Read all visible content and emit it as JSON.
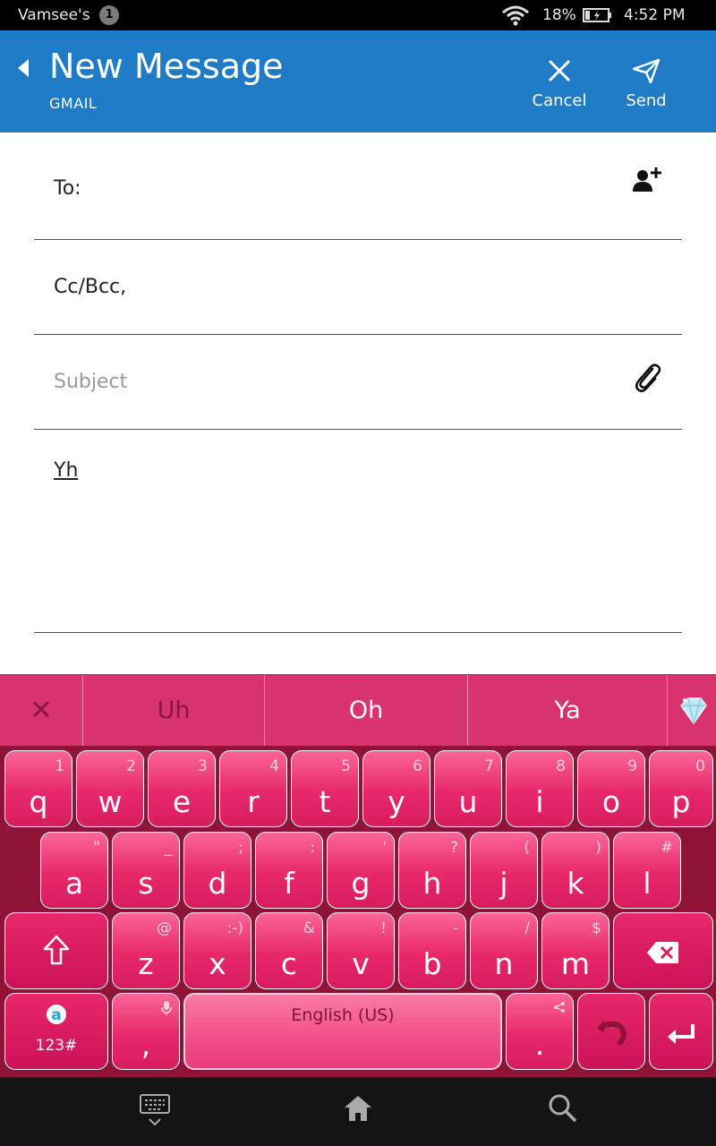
{
  "status_bar": {
    "owner": "Vamsee's",
    "notification_count": "1",
    "battery_percent": "18%",
    "time": "4:52 PM",
    "icons": [
      "wifi-icon",
      "battery-charging-icon"
    ]
  },
  "app_bar": {
    "title": "New Message",
    "subtitle": "GMAIL",
    "cancel_label": "Cancel",
    "send_label": "Send",
    "color": "#1f7bc6"
  },
  "compose": {
    "to_label": "To:",
    "cc_label": "Cc/Bcc,",
    "subject_placeholder": "Subject",
    "body_text": "Yh"
  },
  "suggestions": {
    "close_symbol": "✕",
    "items": [
      "Uh",
      "Oh",
      "Ya"
    ]
  },
  "keyboard": {
    "accent": "#e8286a",
    "row1": [
      {
        "main": "q",
        "sub": "1"
      },
      {
        "main": "w",
        "sub": "2"
      },
      {
        "main": "e",
        "sub": "3"
      },
      {
        "main": "r",
        "sub": "4"
      },
      {
        "main": "t",
        "sub": "5"
      },
      {
        "main": "y",
        "sub": "6"
      },
      {
        "main": "u",
        "sub": "7"
      },
      {
        "main": "i",
        "sub": "8"
      },
      {
        "main": "o",
        "sub": "9"
      },
      {
        "main": "p",
        "sub": "0"
      }
    ],
    "row2": [
      {
        "main": "a",
        "sub": "\""
      },
      {
        "main": "s",
        "sub": "_"
      },
      {
        "main": "d",
        "sub": ";"
      },
      {
        "main": "f",
        "sub": ":"
      },
      {
        "main": "g",
        "sub": "'"
      },
      {
        "main": "h",
        "sub": "?"
      },
      {
        "main": "j",
        "sub": "("
      },
      {
        "main": "k",
        "sub": ")"
      },
      {
        "main": "l",
        "sub": "#"
      }
    ],
    "row3": [
      {
        "main": "z",
        "sub": "@"
      },
      {
        "main": "x",
        "sub": ":-)"
      },
      {
        "main": "c",
        "sub": "&"
      },
      {
        "main": "v",
        "sub": "!"
      },
      {
        "main": "b",
        "sub": "-"
      },
      {
        "main": "n",
        "sub": "/"
      },
      {
        "main": "m",
        "sub": "$"
      }
    ],
    "symbols_label": "123#",
    "comma": ",",
    "space_label": "English (US)",
    "period": "."
  }
}
